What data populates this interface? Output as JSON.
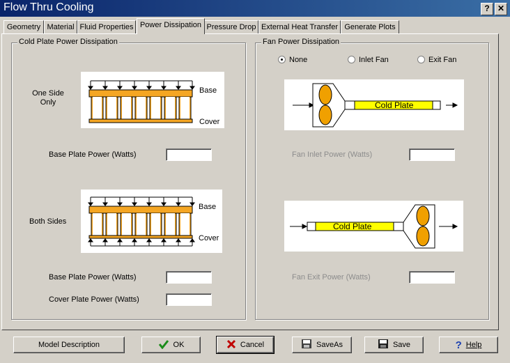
{
  "window": {
    "title": "Flow Thru Cooling",
    "help_glyph": "?",
    "close_glyph": "✕"
  },
  "tabs": [
    {
      "label": "Geometry"
    },
    {
      "label": "Material"
    },
    {
      "label": "Fluid Properties"
    },
    {
      "label": "Power Dissipation",
      "active": true
    },
    {
      "label": "Pressure Drop"
    },
    {
      "label": "External Heat Transfer"
    },
    {
      "label": "Generate Plots"
    }
  ],
  "cold_plate": {
    "group_title": "Cold Plate Power Dissipation",
    "one_side_label": "One Side\nOnly",
    "both_sides_label": "Both Sides",
    "base_label": "Base",
    "cover_label": "Cover",
    "one_side_base_power_label": "Base Plate Power (Watts)",
    "one_side_base_power_value": "",
    "both_sides_base_power_label": "Base Plate Power (Watts)",
    "both_sides_base_power_value": "",
    "both_sides_cover_power_label": "Cover Plate Power (Watts)",
    "both_sides_cover_power_value": ""
  },
  "fan": {
    "group_title": "Fan Power Dissipation",
    "radio_none": "None",
    "radio_inlet": "Inlet Fan",
    "radio_exit": "Exit Fan",
    "selected": "None",
    "cold_plate_label": "Cold Plate",
    "inlet_power_label": "Fan Inlet  Power (Watts)",
    "inlet_power_value": "",
    "exit_power_label": "Fan Exit  Power (Watts)",
    "exit_power_value": ""
  },
  "buttons": {
    "model_description": "Model Description",
    "ok": "OK",
    "cancel": "Cancel",
    "save_as": "SaveAs",
    "save": "Save",
    "help": "Help"
  },
  "colors": {
    "plate_orange": "#f5a623",
    "fan_yellow": "#ffff00",
    "fan_orange": "#f0a000",
    "title_bar": "#0a246a"
  }
}
